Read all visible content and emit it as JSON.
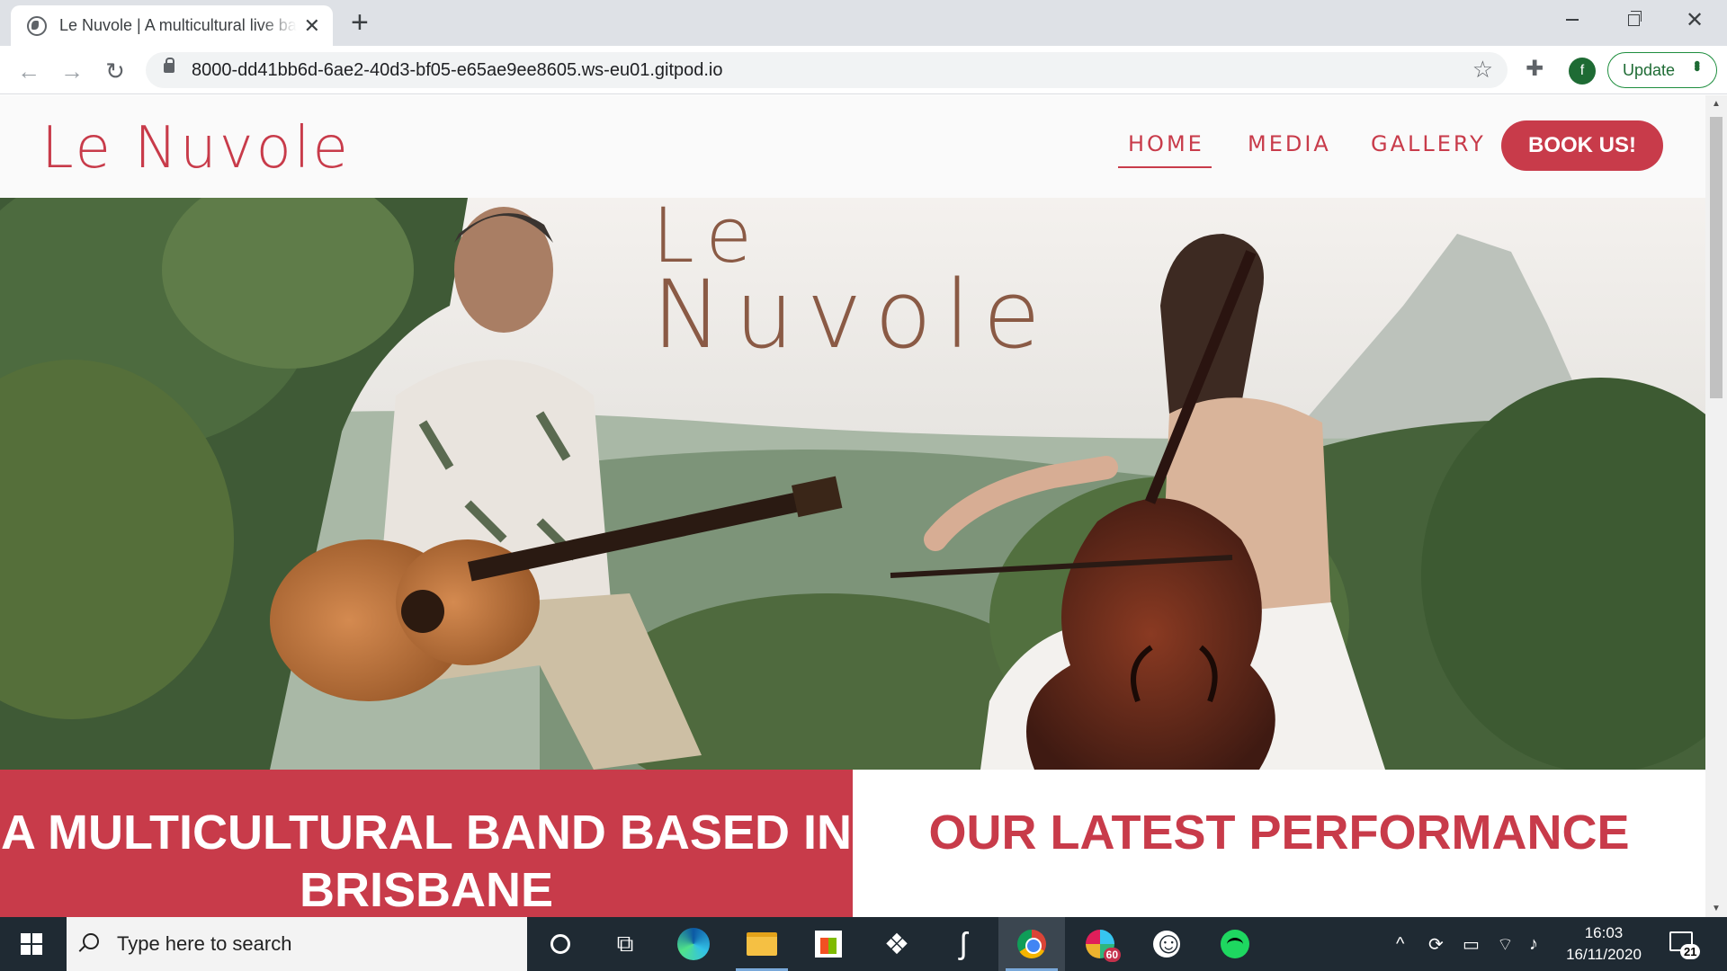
{
  "browser": {
    "tab_title": "Le Nuvole | A multicultural live band",
    "tab_close": "✕",
    "new_tab": "+",
    "url": "8000-dd41bb6d-6ae2-40d3-bf05-e65ae9ee8605.ws-eu01.gitpod.io",
    "profile_initial": "f",
    "update_label": "Update",
    "back_icon": "←",
    "forward_icon": "→",
    "reload_icon": "↻",
    "star_icon": "☆",
    "extensions_icon": "✚"
  },
  "site": {
    "brand": "Le Nuvole",
    "nav": {
      "home": "HOME",
      "media": "MEDIA",
      "gallery": "GALLERY",
      "book": "BOOK US!"
    },
    "hero_logo": {
      "line1": "Le",
      "line2": "Nuvole"
    },
    "panel_left_heading": "A MULTICULTURAL BAND BASED IN BRISBANE",
    "panel_right_heading": "OUR LATEST PERFORMANCE",
    "colors": {
      "accent": "#c83b4a",
      "logo_brown": "#8a5a45"
    }
  },
  "taskbar": {
    "search_placeholder": "Type here to search",
    "slack_badge": "60",
    "time": "16:03",
    "date": "16/11/2020",
    "notification_count": "21",
    "icons": [
      "windows-start",
      "cortana",
      "task-view",
      "edge",
      "file-explorer",
      "microsoft-store",
      "dropbox",
      "scrivener",
      "chrome",
      "slack",
      "emoji-app",
      "spotify"
    ]
  }
}
